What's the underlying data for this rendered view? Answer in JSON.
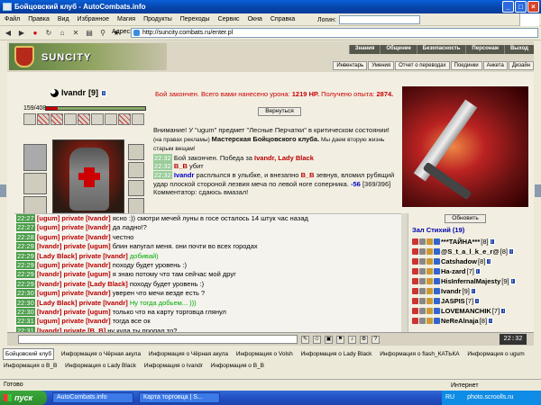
{
  "window": {
    "title": "Бойцовский клуб - AutoCombats.info"
  },
  "menu": [
    "Файл",
    "Правка",
    "Вид",
    "Избранное",
    "Магия",
    "Продукты",
    "Переходы",
    "Сервис",
    "Окна",
    "Справка"
  ],
  "login": {
    "label": "Логин:"
  },
  "address": {
    "label": "Адрес:",
    "url": "http://suncity.combats.ru/enter.pl"
  },
  "site": {
    "name": "SUNCITY",
    "topnav": [
      "Знания",
      "Общение",
      "Безопасность",
      "Персонаж",
      "Выход"
    ],
    "subnav": [
      "Инвентарь",
      "Умения",
      "Отчет о переводах",
      "Поединки",
      "Анкета",
      "Дизайн"
    ]
  },
  "character": {
    "name": "Ivandr",
    "level": "[9]",
    "hp": "159/408",
    "hp_fraction": 0.12
  },
  "battle": {
    "line1": "Бой закончен. Всего вами нанесено урона:",
    "damage": "1219 HP.",
    "line2": "Получено опыта:",
    "exp": "2874.",
    "back_button": "Вернуться"
  },
  "log": [
    {
      "t": "",
      "text": "Внимание! У \"ugum\" предмет \"Лесные Перчатки\" в критическом состоянии!"
    },
    {
      "t": "",
      "adv": "(на правах рекламы) ",
      "strong": "Мастерская Бойцовского клуба.",
      "small": " Мы даем вторую жизнь старым вещам!"
    },
    {
      "t": "22:32",
      "text": " Бой закончен. Победа за ",
      "names": "Ivandr, Lady Black"
    },
    {
      "t": "22:32",
      "names": "B_B",
      "text": " убит"
    },
    {
      "t": "22:32",
      "names": "Ivandr",
      "text": " расплылся в улыбке, и внезапно ",
      "names2": "B_B",
      "text2": " зевнув, вломил рубящий удар плоской стороной лезвия меча по левой ноге соперника. ",
      "dmg": "-56",
      "text3": " [369/396]"
    },
    {
      "t": "",
      "text": "Комментатор: сдаюсь вмазал!"
    }
  ],
  "chat": [
    {
      "t": "22:27",
      "from": "[ugum]",
      "pv": "private",
      "to": "[Ivandr]",
      "msg": "ясно :)) смотри мечей луны в госе осталось 14 штук час назад"
    },
    {
      "t": "22:27",
      "from": "[ugum]",
      "pv": "private",
      "to": "[Ivandr]",
      "msg": "да ладно!?"
    },
    {
      "t": "22:28",
      "from": "[ugum]",
      "pv": "private",
      "to": "[Ivandr]",
      "msg": "честно"
    },
    {
      "t": "22:29",
      "from": "[Ivandr]",
      "pv": "private",
      "to": "[ugum]",
      "msg": "блин напугал меня. они почти во всех городах"
    },
    {
      "t": "22:29",
      "from": "[Lady Black]",
      "pv": "private",
      "to": "[Ivandr]",
      "msg": "добивай)",
      "alt": true
    },
    {
      "t": "22:29",
      "from": "[ugum]",
      "pv": "private",
      "to": "[Ivandr]",
      "msg": "походу будет уровень :)"
    },
    {
      "t": "22:29",
      "from": "[Ivandr]",
      "pv": "private",
      "to": "[ugum]",
      "msg": "я знаю потому что там сейчас мой друг"
    },
    {
      "t": "22:29",
      "from": "[Ivandr]",
      "pv": "private",
      "to": "[Lady Black]",
      "msg": "походу будет уровень :)"
    },
    {
      "t": "22:30",
      "from": "[ugum]",
      "pv": "private",
      "to": "[Ivandr]",
      "msg": "уверен что мечи везде есть ?"
    },
    {
      "t": "22:30",
      "from": "[Lady Black]",
      "pv": "private",
      "to": "[Ivandr]",
      "msg": "Ну тогда добьем... )))",
      "alt": true
    },
    {
      "t": "22:30",
      "from": "[Ivandr]",
      "pv": "private",
      "to": "[ugum]",
      "msg": "только что на карту торговца глянул"
    },
    {
      "t": "22:31",
      "from": "[ugum]",
      "pv": "private",
      "to": "[Ivandr]",
      "msg": "тогда все ок"
    },
    {
      "t": "22:31",
      "from": "[Ivandr]",
      "pv": "private",
      "to": "[B_B]",
      "msg": "ну куда ты пропал то?"
    },
    {
      "t": "22:32",
      "from": "[Ivandr]",
      "pv": "private",
      "to": "[Lady Black]",
      "msg": "ударь его"
    }
  ],
  "users": {
    "refresh": "Обновить",
    "room": "Зал Стихий",
    "count": "(19)",
    "list": [
      {
        "name": "***ТАЙНА***",
        "lvl": "[8]"
      },
      {
        "name": "@S_t_a_l_k_e_r@",
        "lvl": "[8]"
      },
      {
        "name": "Catshadow",
        "lvl": "[8]"
      },
      {
        "name": "Ha-zard",
        "lvl": "[7]"
      },
      {
        "name": "HisInfernalMajesty",
        "lvl": "[9]"
      },
      {
        "name": "Ivandr",
        "lvl": "[9]"
      },
      {
        "name": "JASPIS",
        "lvl": "[7]"
      },
      {
        "name": "LOVEMANCHIK",
        "lvl": "[7]"
      },
      {
        "name": "NeReAlnaja",
        "lvl": "[8]"
      }
    ]
  },
  "clock": "22:32",
  "tabs": [
    "Бойцовский клуб",
    "Информация о Чёрная акула",
    "Информация о Чёрная акула",
    "Информация о Volsh",
    "Информация о Lady Black",
    "Информация о flash_КАТЬКА",
    "Информация о ugum",
    "Информация о B_B",
    "Информация о Lady Black",
    "Информация о Ivandr",
    "Информация о B_B"
  ],
  "status": {
    "left": "Готово",
    "zone": "Интернет"
  },
  "taskbar": {
    "start": "пуск",
    "items": [
      "AutoCombats.info",
      "Карта торговца | S..."
    ],
    "lang": "RU",
    "watermark": "photo.scroolls.ru"
  },
  "colors": {
    "accent": "#cc0000",
    "chat_time": "#4b9e4b",
    "taskbar": "#2250c4"
  }
}
